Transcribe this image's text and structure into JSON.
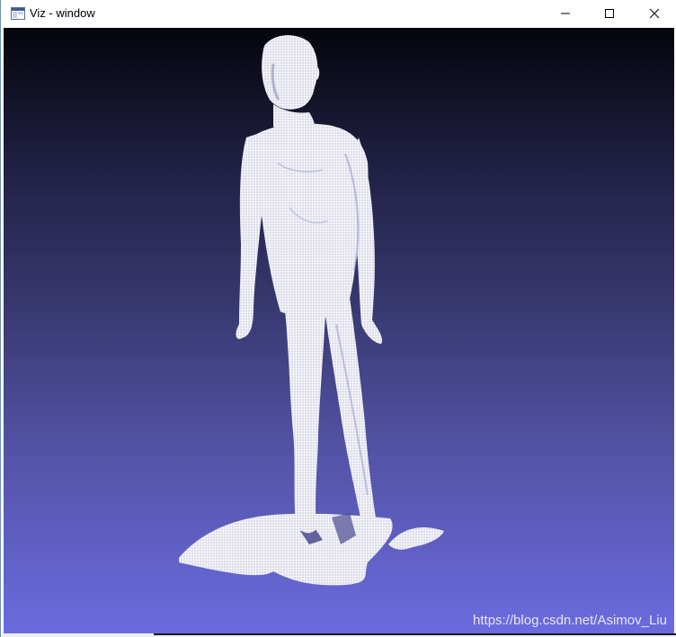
{
  "window": {
    "title": "Viz - window",
    "icon": "app-window-icon",
    "controls": {
      "minimize": "minimize-icon",
      "maximize": "maximize-icon",
      "close": "close-icon"
    }
  },
  "viewport": {
    "content": "point-cloud-human-figure",
    "watermark": "https://blog.csdn.net/Asimov_Liu",
    "background_top": "#05050c",
    "background_bottom": "#6b6bdf",
    "point_color": "#f2f2f8"
  }
}
